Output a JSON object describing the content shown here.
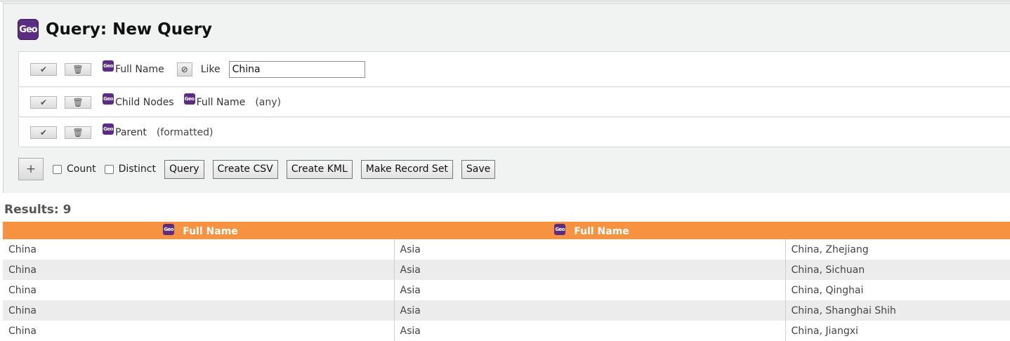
{
  "logo": {
    "text": "Geo"
  },
  "page": {
    "title": "Query: New Query"
  },
  "criteria": [
    {
      "field_icon": "geo-logo-icon",
      "field": "Full Name",
      "not_icon": "not-icon",
      "operator": "Like",
      "value": "China"
    },
    {
      "field_icon": "geo-logo-icon",
      "field": "Child Nodes",
      "sub_field_icon": "geo-logo-icon",
      "sub_field": "Full Name",
      "modifier": "(any)"
    },
    {
      "field_icon": "geo-logo-icon",
      "field": "Parent",
      "modifier": "(formatted)"
    }
  ],
  "actions": {
    "add_label": "+",
    "count_label": "Count",
    "count_checked": false,
    "distinct_label": "Distinct",
    "distinct_checked": false,
    "query_label": "Query",
    "csv_label": "Create CSV",
    "kml_label": "Create KML",
    "recordset_label": "Make Record Set",
    "save_label": "Save"
  },
  "results": {
    "label": "Results: 9",
    "columns": [
      "Full Name",
      "Full Name",
      ""
    ],
    "rows": [
      [
        "China",
        "Asia",
        "China, Zhejiang"
      ],
      [
        "China",
        "Asia",
        "China, Sichuan"
      ],
      [
        "China",
        "Asia",
        "China, Qinghai"
      ],
      [
        "China",
        "Asia",
        "China, Shanghai Shih"
      ],
      [
        "China",
        "Asia",
        "China, Jiangxi"
      ]
    ]
  },
  "colors": {
    "header_orange": "#f79240",
    "geo_purple": "#5a2d82",
    "row_alt": "#ececec"
  }
}
